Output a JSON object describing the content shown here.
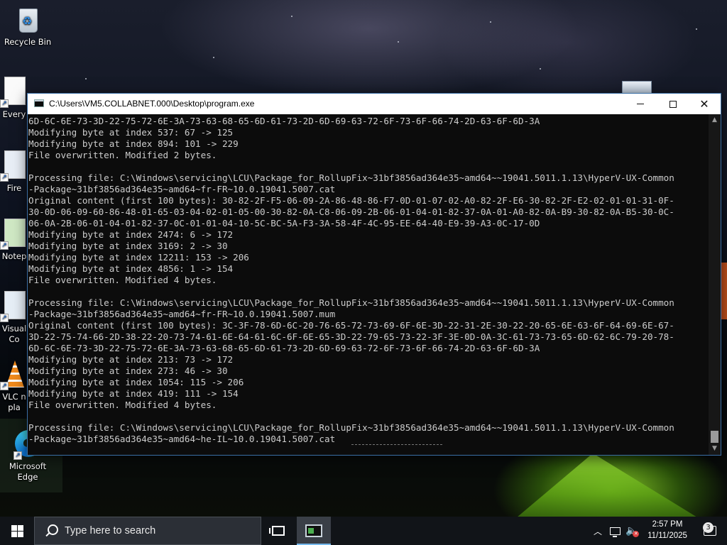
{
  "desktop": {
    "icons": [
      {
        "label": "Recycle Bin",
        "icon": "recycle-bin-icon"
      },
      {
        "label": "Every",
        "icon": "document-icon"
      },
      {
        "label": "Fire",
        "icon": "firefox-icon"
      },
      {
        "label": "Notep",
        "icon": "notepad-icon"
      },
      {
        "label": "Visual",
        "label2": "Co",
        "icon": "visual-studio-code-icon"
      },
      {
        "label": "VLC n",
        "label2": "pla",
        "icon": "vlc-icon"
      },
      {
        "label": "Microsoft",
        "label2": "Edge",
        "icon": "edge-icon"
      }
    ]
  },
  "window": {
    "title": "C:\\Users\\VM5.COLLABNET.000\\Desktop\\program.exe",
    "icon": "console-app-icon",
    "controls": {
      "minimize": "minimize-icon",
      "maximize": "maximize-icon",
      "close": "close-icon"
    }
  },
  "console": {
    "lines": [
      "6D-6C-6E-73-3D-22-75-72-6E-3A-73-63-68-65-6D-61-73-2D-6D-69-63-72-6F-73-6F-66-74-2D-63-6F-6D-3A",
      "Modifying byte at index 537: 67 -> 125",
      "Modifying byte at index 894: 101 -> 229",
      "File overwritten. Modified 2 bytes.",
      "",
      "Processing file: C:\\Windows\\servicing\\LCU\\Package_for_RollupFix~31bf3856ad364e35~amd64~~19041.5011.1.13\\HyperV-UX-Common",
      "-Package~31bf3856ad364e35~amd64~fr-FR~10.0.19041.5007.cat",
      "Original content (first 100 bytes): 30-82-2F-F5-06-09-2A-86-48-86-F7-0D-01-07-02-A0-82-2F-E6-30-82-2F-E2-02-01-01-31-0F-",
      "30-0D-06-09-60-86-48-01-65-03-04-02-01-05-00-30-82-0A-C8-06-09-2B-06-01-04-01-82-37-0A-01-A0-82-0A-B9-30-82-0A-B5-30-0C-",
      "06-0A-2B-06-01-04-01-82-37-0C-01-01-04-10-5C-BC-5A-F3-3A-58-4F-4C-95-EE-64-40-E9-39-A3-0C-17-0D",
      "Modifying byte at index 2474: 6 -> 172",
      "Modifying byte at index 3169: 2 -> 30",
      "Modifying byte at index 12211: 153 -> 206",
      "Modifying byte at index 4856: 1 -> 154",
      "File overwritten. Modified 4 bytes.",
      "",
      "Processing file: C:\\Windows\\servicing\\LCU\\Package_for_RollupFix~31bf3856ad364e35~amd64~~19041.5011.1.13\\HyperV-UX-Common",
      "-Package~31bf3856ad364e35~amd64~fr-FR~10.0.19041.5007.mum",
      "Original content (first 100 bytes): 3C-3F-78-6D-6C-20-76-65-72-73-69-6F-6E-3D-22-31-2E-30-22-20-65-6E-63-6F-64-69-6E-67-",
      "3D-22-75-74-66-2D-38-22-20-73-74-61-6E-64-61-6C-6F-6E-65-3D-22-79-65-73-22-3F-3E-0D-0A-3C-61-73-73-65-6D-62-6C-79-20-78-",
      "6D-6C-6E-73-3D-22-75-72-6E-3A-73-63-68-65-6D-61-73-2D-6D-69-63-72-6F-73-6F-66-74-2D-63-6F-6D-3A",
      "Modifying byte at index 213: 73 -> 172",
      "Modifying byte at index 273: 46 -> 30",
      "Modifying byte at index 1054: 115 -> 206",
      "Modifying byte at index 419: 111 -> 154",
      "File overwritten. Modified 4 bytes.",
      "",
      "Processing file: C:\\Windows\\servicing\\LCU\\Package_for_RollupFix~31bf3856ad364e35~amd64~~19041.5011.1.13\\HyperV-UX-Common",
      "-Package~31bf3856ad364e35~amd64~he-IL~10.0.19041.5007.cat"
    ],
    "text_color": "#cccccc",
    "background": "#0c0c0c"
  },
  "taskbar": {
    "search_placeholder": "Type here to search",
    "start_icon": "windows-logo-icon",
    "task_view_icon": "task-view-icon",
    "pinned_app_icon": "console-window-icon",
    "tray": {
      "chevron_icon": "chevron-up-icon",
      "network_icon": "network-icon",
      "volume_icon": "volume-muted-icon"
    },
    "clock": {
      "time": "2:57 PM",
      "date": "11/11/2025"
    },
    "notifications": {
      "icon": "action-center-icon",
      "count": "3"
    }
  }
}
